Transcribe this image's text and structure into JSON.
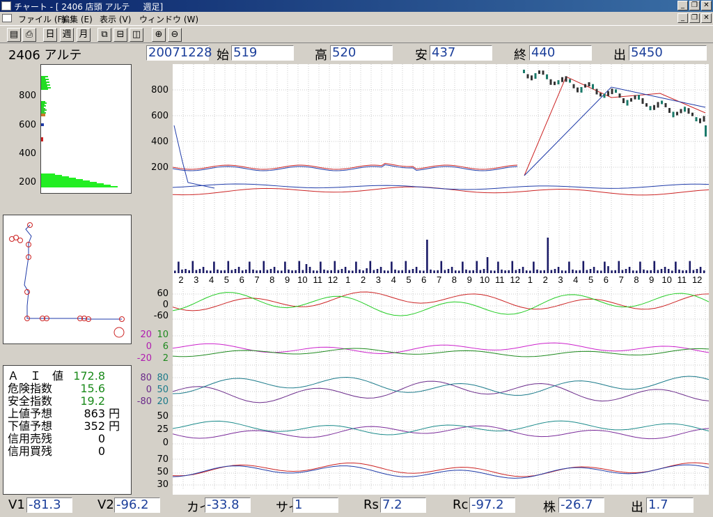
{
  "window": {
    "title": "チャート - [ 2406 店頭 アルテ     週足]"
  },
  "menu": {
    "items": [
      "ファイル (F)",
      "編集 (E)",
      "表示 (V)",
      "ウィンドウ (W)"
    ]
  },
  "toolbar": {
    "day": "日",
    "week": "週",
    "month": "月"
  },
  "header": {
    "stock": "2406  アルテ",
    "date": "20071228",
    "open_label": "始",
    "open": "519",
    "high_label": "高",
    "high": "520",
    "low_label": "安",
    "low": "437",
    "close_label": "終",
    "close": "440",
    "volume_label": "出",
    "volume": "5450"
  },
  "price_axis": [
    "800",
    "600",
    "400",
    "200"
  ],
  "ai": [
    {
      "label": "Ａ　Ｉ　値",
      "value": "172.8",
      "unit": "",
      "color": "#1a8a1a"
    },
    {
      "label": "危険指数",
      "value": "15.6",
      "unit": "",
      "color": "#1a8a1a"
    },
    {
      "label": "安全指数",
      "value": "19.2",
      "unit": "",
      "color": "#1a8a1a"
    },
    {
      "label": "上値予想",
      "value": "863",
      "unit": "円",
      "color": "#000000"
    },
    {
      "label": "下値予想",
      "value": "352",
      "unit": "円",
      "color": "#000000"
    },
    {
      "label": "信用売残",
      "value": "0",
      "unit": "",
      "color": "#000000"
    },
    {
      "label": "信用買残",
      "value": "0",
      "unit": "",
      "color": "#000000"
    }
  ],
  "bottom": {
    "v1_label": "V1",
    "v1": "-81.3",
    "v2_label": "V2",
    "v2": "-96.2",
    "kai_label": "カイ",
    "kai": "-33.8",
    "sai_label": "サイ",
    "sai": "1",
    "rs_label": "Rs",
    "rs": "7.2",
    "rc_label": "Rc",
    "rc": "-97.2",
    "kabu_label": "株",
    "kabu": "-26.7",
    "de_label": "出",
    "de": "1.7"
  },
  "chart_data": {
    "type": "line",
    "price_ticks": [
      "800",
      "600",
      "400",
      "200"
    ],
    "month_labels": [
      "2",
      "3",
      "4",
      "5",
      "6",
      "7",
      "8",
      "9",
      "10",
      "11",
      "12",
      "1",
      "2",
      "3",
      "4",
      "5",
      "6",
      "7",
      "8",
      "9",
      "10",
      "11",
      "12",
      "1",
      "2",
      "3",
      "4",
      "5",
      "6",
      "7",
      "8",
      "9",
      "10",
      "11",
      "12"
    ],
    "osc1_ticks": [
      "60",
      "0",
      "-60"
    ],
    "osc2_ticks_left": [
      "20",
      "0",
      "-20"
    ],
    "osc2_ticks_right": [
      "10",
      "6",
      "2"
    ],
    "osc3_ticks_left": [
      "80",
      "0",
      "-80"
    ],
    "osc3_ticks_right": [
      "80",
      "50",
      "20"
    ],
    "osc4_ticks": [
      "50",
      "25",
      "0"
    ],
    "osc5_ticks": [
      "70",
      "50",
      "30"
    ]
  }
}
